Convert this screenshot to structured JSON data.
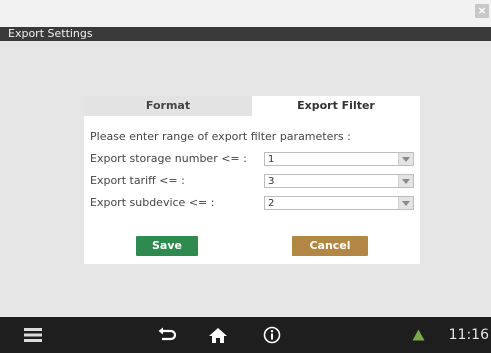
{
  "window": {
    "title": "Export Settings",
    "close_glyph": "×"
  },
  "tabs": [
    {
      "label": "Format",
      "active": false
    },
    {
      "label": "Export Filter",
      "active": true
    }
  ],
  "filter": {
    "prompt": "Please enter range of export filter parameters :",
    "rows": [
      {
        "label": "Export storage number <= :",
        "value": "1"
      },
      {
        "label": "Export tariff <= :",
        "value": "3"
      },
      {
        "label": "Export subdevice <= :",
        "value": "2"
      }
    ]
  },
  "buttons": {
    "save": "Save",
    "cancel": "Cancel"
  },
  "taskbar": {
    "icons": [
      "menu-icon",
      "back-icon",
      "home-icon",
      "info-icon",
      "warning-icon"
    ],
    "time": "11:16"
  },
  "colors": {
    "title_bar": "#3a3a3a",
    "save_button": "#2f8a4f",
    "cancel_button": "#b38645",
    "warning": "#7aa84a",
    "bottom_bar": "#1e1e1e"
  }
}
